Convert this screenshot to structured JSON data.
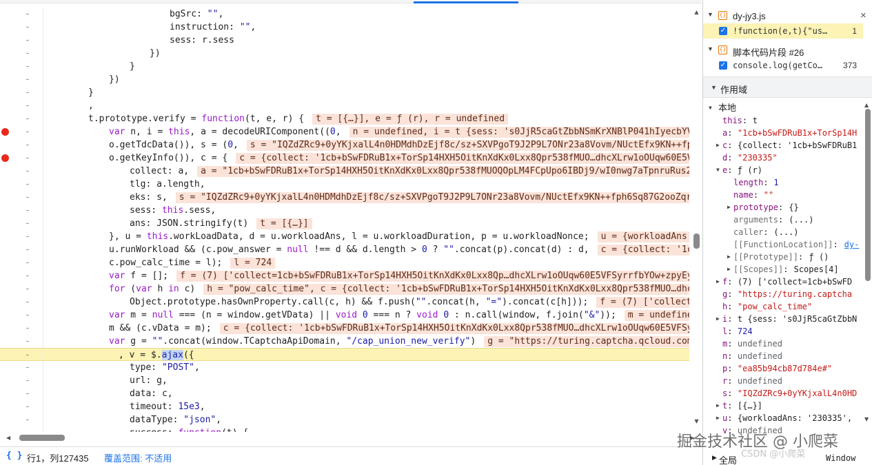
{
  "code_lines": [
    {
      "bp": false,
      "hl": false,
      "segs": [
        {
          "t": "bgSrc: ",
          "c": "pn"
        },
        {
          "t": "\"\"",
          "c": "str"
        },
        {
          "t": ",",
          "c": "pn"
        }
      ]
    },
    {
      "bp": false,
      "hl": false,
      "segs": [
        {
          "t": "instruction: ",
          "c": "pn"
        },
        {
          "t": "\"\"",
          "c": "str"
        },
        {
          "t": ",",
          "c": "pn"
        }
      ]
    },
    {
      "bp": false,
      "hl": false,
      "segs": [
        {
          "t": "sess: r.sess",
          "c": "pn"
        }
      ]
    },
    {
      "bp": false,
      "hl": false,
      "segs": [
        {
          "t": "})",
          "c": "pn"
        }
      ]
    },
    {
      "bp": false,
      "hl": false,
      "segs": [
        {
          "t": "}",
          "c": "pn"
        }
      ]
    },
    {
      "bp": false,
      "hl": false,
      "segs": [
        {
          "t": "})",
          "c": "pn"
        }
      ]
    },
    {
      "bp": false,
      "hl": false,
      "segs": [
        {
          "t": "}",
          "c": "pn"
        }
      ]
    },
    {
      "bp": false,
      "hl": false,
      "segs": [
        {
          "t": ",",
          "c": "pn"
        }
      ]
    },
    {
      "bp": false,
      "hl": false,
      "segs": [
        {
          "t": "t.prototype.verify = ",
          "c": "pn"
        },
        {
          "t": "function",
          "c": "kw"
        },
        {
          "t": "(t, e, r) {",
          "c": "pn"
        }
      ],
      "inline": "t = [{…}], e = ƒ (r), r = undefined"
    },
    {
      "bp": true,
      "hl": false,
      "segs": [
        {
          "t": "var",
          "c": "kw"
        },
        {
          "t": " n, i = ",
          "c": "pn"
        },
        {
          "t": "this",
          "c": "kw"
        },
        {
          "t": ", a = decodeURIComponent((",
          "c": "pn"
        },
        {
          "t": "0",
          "c": "num"
        },
        {
          "t": ",",
          "c": "pn"
        }
      ],
      "inline": "n = undefined, i = t {sess: 's0JjR5caGtZbbNSmKrXNBlP041hIyecbYVfL53aA"
    },
    {
      "bp": false,
      "hl": false,
      "segs": [
        {
          "t": "o.getTdcData()), s = (",
          "c": "pn"
        },
        {
          "t": "0",
          "c": "num"
        },
        {
          "t": ",",
          "c": "pn"
        }
      ],
      "inline": "s = \"IQZdZRc9+0yYKjxalL4n0HDMdhDzEjf8c/sz+SXVPgoT9J2P9L7ONr23a8Vovm/NUctEfx9KN++fph6Sq87G2ooZ"
    },
    {
      "bp": true,
      "hl": false,
      "segs": [
        {
          "t": "o.getKeyInfo()), c = {",
          "c": "pn"
        }
      ],
      "inline": "c = {collect: '1cb+bSwFDRuB1x+TorSp14HXH5OitKnXdKx0Lxx8Qpr538fMUO…dhcXLrw1oOUqw60E5VFSyrrfbYOw+zpyEywhZ1jdqpOPP"
    },
    {
      "bp": false,
      "hl": false,
      "segs": [
        {
          "t": "collect: a,",
          "c": "pn"
        }
      ],
      "inline": "a = \"1cb+bSwFDRuB1x+TorSp14HXH5OitKnXdKx0Lxx8Qpr538fMUOQOpLM4FCpUpo6IBDj9/wI0nwg7aTpnruRus2Zw9uoC"
    },
    {
      "bp": false,
      "hl": false,
      "segs": [
        {
          "t": "tlg: a.length,",
          "c": "pn"
        }
      ]
    },
    {
      "bp": false,
      "hl": false,
      "segs": [
        {
          "t": "eks: s,",
          "c": "pn"
        }
      ],
      "inline": "s = \"IQZdZRc9+0yYKjxalL4n0HDMdhDzEjf8c/sz+SXVPgoT9J2P9L7ONr23a8Vovm/NUctEfx9KN++fph6Sq87G2ooZqrWAht0/"
    },
    {
      "bp": false,
      "hl": false,
      "segs": [
        {
          "t": "sess: ",
          "c": "pn"
        },
        {
          "t": "this",
          "c": "kw"
        },
        {
          "t": ".sess,",
          "c": "pn"
        }
      ]
    },
    {
      "bp": false,
      "hl": false,
      "segs": [
        {
          "t": "ans: JSON.stringify(t)",
          "c": "pn"
        }
      ],
      "inline": "t = [{…}]"
    },
    {
      "bp": false,
      "hl": false,
      "segs": [
        {
          "t": "}, u = ",
          "c": "pn"
        },
        {
          "t": "this",
          "c": "kw"
        },
        {
          "t": ".workLoadData, d = u.workloadAns, l = u.workloadDuration, p = u.workloadNonce;",
          "c": "pn"
        }
      ],
      "inline": "u = {workloadAns: '230335'"
    },
    {
      "bp": false,
      "hl": false,
      "segs": [
        {
          "t": "u.runWorkload && (c.pow_answer = ",
          "c": "pn"
        },
        {
          "t": "null",
          "c": "kw"
        },
        {
          "t": " !== d && d.length > ",
          "c": "pn"
        },
        {
          "t": "0",
          "c": "num"
        },
        {
          "t": " ? ",
          "c": "pn"
        },
        {
          "t": "\"\"",
          "c": "str"
        },
        {
          "t": ".concat(p).concat(d) : d,",
          "c": "pn"
        }
      ],
      "inline": "c = {collect: '1cb+bSwFD"
    },
    {
      "bp": false,
      "hl": false,
      "segs": [
        {
          "t": "c.pow_calc_time = l);",
          "c": "pn"
        }
      ],
      "inline": "l = 724"
    },
    {
      "bp": false,
      "hl": false,
      "segs": [
        {
          "t": "var",
          "c": "kw"
        },
        {
          "t": " f = [];",
          "c": "pn"
        }
      ],
      "inline": "f = (7) ['collect=1cb+bSwFDRuB1x+TorSp14HXH5OitKnXdKx0Lxx8Qp…dhcXLrw1oOUqw60E5VFSyrrfbYOw+zpyEywhZ1jdqp"
    },
    {
      "bp": false,
      "hl": false,
      "segs": [
        {
          "t": "for",
          "c": "kw"
        },
        {
          "t": " (",
          "c": "pn"
        },
        {
          "t": "var",
          "c": "kw"
        },
        {
          "t": " h ",
          "c": "pn"
        },
        {
          "t": "in",
          "c": "kw"
        },
        {
          "t": " c)",
          "c": "pn"
        }
      ],
      "inline": "h = \"pow_calc_time\", c = {collect: '1cb+bSwFDRuB1x+TorSp14HXH5OitKnXdKx0Lxx8Qpr538fMUO…dhcXLrw1oOUq"
    },
    {
      "bp": false,
      "hl": false,
      "segs": [
        {
          "t": "Object.prototype.hasOwnProperty.call(c, h) && f.push(",
          "c": "pn"
        },
        {
          "t": "\"\"",
          "c": "str"
        },
        {
          "t": ".concat(h, ",
          "c": "pn"
        },
        {
          "t": "\"=\"",
          "c": "str"
        },
        {
          "t": ").concat(c[h]));",
          "c": "pn"
        }
      ],
      "inline": "f = (7) ['collect=1cb+bSwFD"
    },
    {
      "bp": false,
      "hl": false,
      "segs": [
        {
          "t": "var",
          "c": "kw"
        },
        {
          "t": " m = ",
          "c": "pn"
        },
        {
          "t": "null",
          "c": "kw"
        },
        {
          "t": " === (n = window.getVData) || ",
          "c": "pn"
        },
        {
          "t": "void",
          "c": "kw"
        },
        {
          "t": " ",
          "c": "pn"
        },
        {
          "t": "0",
          "c": "num"
        },
        {
          "t": " === n ? ",
          "c": "pn"
        },
        {
          "t": "void",
          "c": "kw"
        },
        {
          "t": " ",
          "c": "pn"
        },
        {
          "t": "0",
          "c": "num"
        },
        {
          "t": " : n.call(window, f.join(",
          "c": "pn"
        },
        {
          "t": "\"&\"",
          "c": "str"
        },
        {
          "t": "));",
          "c": "pn"
        }
      ],
      "inline": "m = undefined, n = undefin"
    },
    {
      "bp": false,
      "hl": false,
      "segs": [
        {
          "t": "m && (c.vData = m);",
          "c": "pn"
        }
      ],
      "inline": "c = {collect: '1cb+bSwFDRuB1x+TorSp14HXH5OitKnXdKx0Lxx8Qpr538fMUO…dhcXLrw1oOUqw60E5VFSyrrfbYOw+zpyEywhZ1"
    },
    {
      "bp": false,
      "hl": false,
      "segs": [
        {
          "t": "var",
          "c": "kw"
        },
        {
          "t": " g = ",
          "c": "pn"
        },
        {
          "t": "\"\"",
          "c": "str"
        },
        {
          "t": ".concat(window.TCaptchaApiDomain, ",
          "c": "pn"
        },
        {
          "t": "\"/cap_union_new_verify\"",
          "c": "str"
        },
        {
          "t": ")",
          "c": "pn"
        }
      ],
      "inline": "g = \"https://turing.captcha.qcloud.com/cap_union_n"
    },
    {
      "bp": false,
      "hl": true,
      "segs": [
        {
          "t": ", v = $.",
          "c": "pn"
        },
        {
          "t": "ajax",
          "c": "sel"
        },
        {
          "t": "({",
          "c": "pn"
        }
      ]
    },
    {
      "bp": false,
      "hl": false,
      "segs": [
        {
          "t": "type: ",
          "c": "pn"
        },
        {
          "t": "\"POST\"",
          "c": "str"
        },
        {
          "t": ",",
          "c": "pn"
        }
      ]
    },
    {
      "bp": false,
      "hl": false,
      "segs": [
        {
          "t": "url: g,",
          "c": "pn"
        }
      ]
    },
    {
      "bp": false,
      "hl": false,
      "segs": [
        {
          "t": "data: c,",
          "c": "pn"
        }
      ]
    },
    {
      "bp": false,
      "hl": false,
      "segs": [
        {
          "t": "timeout: ",
          "c": "pn"
        },
        {
          "t": "15e3",
          "c": "num"
        },
        {
          "t": ",",
          "c": "pn"
        }
      ]
    },
    {
      "bp": false,
      "hl": false,
      "segs": [
        {
          "t": "dataType: ",
          "c": "pn"
        },
        {
          "t": "\"json\"",
          "c": "str"
        },
        {
          "t": ",",
          "c": "pn"
        }
      ]
    },
    {
      "bp": false,
      "hl": false,
      "segs": [
        {
          "t": "success: ",
          "c": "pn"
        },
        {
          "t": "function",
          "c": "kw"
        },
        {
          "t": "(t) {",
          "c": "pn"
        }
      ]
    }
  ],
  "gutter_marker": "-",
  "statusbar": {
    "braces": "{ }",
    "position": "行1，列127435",
    "coverage": "覆盖范围: 不适用"
  },
  "breakpoints_panel": {
    "files": [
      {
        "name": "dy-jy3.js",
        "icon": "{}",
        "entries": [
          {
            "code": "!function(e,t){\"us…",
            "line": "1",
            "active": true
          }
        ]
      },
      {
        "name": "脚本代码片段 #26",
        "icon": "{}",
        "entries": [
          {
            "code": "console.log(getCo…",
            "line": "373",
            "active": false
          }
        ]
      }
    ],
    "close_icon": "×"
  },
  "scope": {
    "header": "作用域",
    "local_label": "本地",
    "rows": [
      {
        "tri": "",
        "key": "this",
        "sep": ": ",
        "val": "t",
        "vc": "v-obj"
      },
      {
        "tri": "",
        "key": "a",
        "sep": ": ",
        "val": "\"1cb+bSwFDRuB1x+TorSp14H",
        "vc": "v-str"
      },
      {
        "tri": "▶",
        "key": "c",
        "sep": ": ",
        "val": "{collect: '1cb+bSwFDRuB1",
        "vc": "v-obj"
      },
      {
        "tri": "",
        "key": "d",
        "sep": ": ",
        "val": "\"230335\"",
        "vc": "v-str"
      },
      {
        "tri": "▼",
        "key": "e",
        "sep": ": ",
        "val": "ƒ (r)",
        "vc": "v-obj"
      },
      {
        "tri": "",
        "key": "length",
        "sep": ": ",
        "val": "1",
        "vc": "v-num",
        "indent": 1
      },
      {
        "tri": "",
        "key": "name",
        "sep": ": ",
        "val": "\"\"",
        "vc": "v-str",
        "indent": 1
      },
      {
        "tri": "▶",
        "key": "prototype",
        "sep": ": ",
        "val": "{}",
        "vc": "v-obj",
        "indent": 1
      },
      {
        "tri": "",
        "key": "arguments",
        "sep": ": ",
        "val": "(...)",
        "vc": "v-obj",
        "indent": 1,
        "grey": true
      },
      {
        "tri": "",
        "key": "caller",
        "sep": ": ",
        "val": "(...)",
        "vc": "v-obj",
        "indent": 1,
        "grey": true
      },
      {
        "tri": "",
        "key": "[[FunctionLocation]]",
        "sep": ": ",
        "val": "dy-",
        "vc": "v-link",
        "indent": 1,
        "grey": true
      },
      {
        "tri": "▶",
        "key": "[[Prototype]]",
        "sep": ": ",
        "val": "ƒ ()",
        "vc": "v-obj",
        "indent": 1,
        "grey": true
      },
      {
        "tri": "▶",
        "key": "[[Scopes]]",
        "sep": ": ",
        "val": "Scopes[4]",
        "vc": "v-obj",
        "indent": 1,
        "grey": true
      },
      {
        "tri": "▶",
        "key": "f",
        "sep": ": ",
        "val": "(7) ['collect=1cb+bSwFD",
        "vc": "v-obj"
      },
      {
        "tri": "",
        "key": "g",
        "sep": ": ",
        "val": "\"https://turing.captcha",
        "vc": "v-str"
      },
      {
        "tri": "",
        "key": "h",
        "sep": ": ",
        "val": "\"pow_calc_time\"",
        "vc": "v-str"
      },
      {
        "tri": "▶",
        "key": "i",
        "sep": ": ",
        "val": "t {sess: 's0JjR5caGtZbbN",
        "vc": "v-obj"
      },
      {
        "tri": "",
        "key": "l",
        "sep": ": ",
        "val": "724",
        "vc": "v-num"
      },
      {
        "tri": "",
        "key": "m",
        "sep": ": ",
        "val": "undefined",
        "vc": "v-undef"
      },
      {
        "tri": "",
        "key": "n",
        "sep": ": ",
        "val": "undefined",
        "vc": "v-undef"
      },
      {
        "tri": "",
        "key": "p",
        "sep": ": ",
        "val": "\"ea85b94cb87d784e#\"",
        "vc": "v-str"
      },
      {
        "tri": "",
        "key": "r",
        "sep": ": ",
        "val": "undefined",
        "vc": "v-undef"
      },
      {
        "tri": "",
        "key": "s",
        "sep": ": ",
        "val": "\"IQZdZRc9+0yYKjxalL4n0HD",
        "vc": "v-str"
      },
      {
        "tri": "▶",
        "key": "t",
        "sep": ": ",
        "val": "[{…}]",
        "vc": "v-obj"
      },
      {
        "tri": "▶",
        "key": "u",
        "sep": ": ",
        "val": "{workloadAns: '230335',",
        "vc": "v-obj"
      },
      {
        "tri": "",
        "key": "v",
        "sep": ": ",
        "val": "undefined",
        "vc": "v-undef"
      }
    ],
    "global_label": "全局",
    "global_value": "Window"
  },
  "watermark": "掘金技术社区 @ 小爬菜",
  "watermark_sub": "CSDN @小爬菜"
}
